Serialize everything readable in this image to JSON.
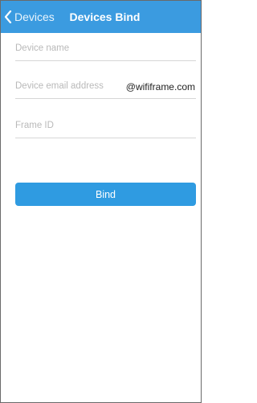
{
  "navbar": {
    "back_label": "Devices",
    "title": "Devices Bind",
    "color": "#3b9be0"
  },
  "form": {
    "device_name": {
      "placeholder": "Device name",
      "value": ""
    },
    "device_email": {
      "placeholder": "Device email address",
      "value": "",
      "suffix": "@wififrame.com"
    },
    "frame_id": {
      "placeholder": "Frame ID",
      "value": ""
    }
  },
  "bind_button": {
    "label": "Bind",
    "color": "#2f9be1"
  },
  "icons": {
    "back": "chevron-left-icon"
  }
}
